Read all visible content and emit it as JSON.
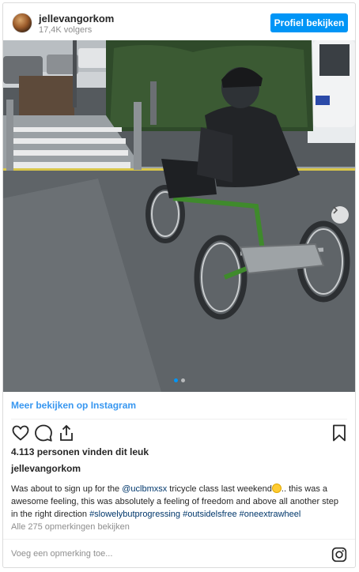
{
  "header": {
    "username": "jellevangorkom",
    "followers": "17,4K volgers",
    "profile_button": "Profiel bekijken"
  },
  "media": {
    "slides_total": 2,
    "active_slide": 1
  },
  "view_more": "Meer bekijken op Instagram",
  "likes": "4.113 personen vinden dit leuk",
  "caption": {
    "username": "jellevangorkom",
    "text_1": "Was about to sign up for the ",
    "mention": "@uclbmxsx",
    "text_2": " tricycle class last weekend",
    "text_3": ".. this was a awesome feeling, this was absolutely a feeling of freedom and above all another step in the right direction ",
    "tags": [
      "#slowelybutprogressing",
      "#outsidelsfree",
      "#oneextrawheel"
    ]
  },
  "comments_link": "Alle 275 opmerkingen bekijken",
  "comment_placeholder": "Voeg een opmerking toe...",
  "colors": {
    "button": "#0095f6",
    "link": "#3897f0",
    "text": "#262626",
    "muted": "#8e8e8e"
  },
  "icons": {
    "like": "heart-icon",
    "comment": "comment-icon",
    "share": "share-icon",
    "save": "bookmark-icon",
    "brand": "instagram-icon",
    "next": "chevron-right-icon"
  }
}
